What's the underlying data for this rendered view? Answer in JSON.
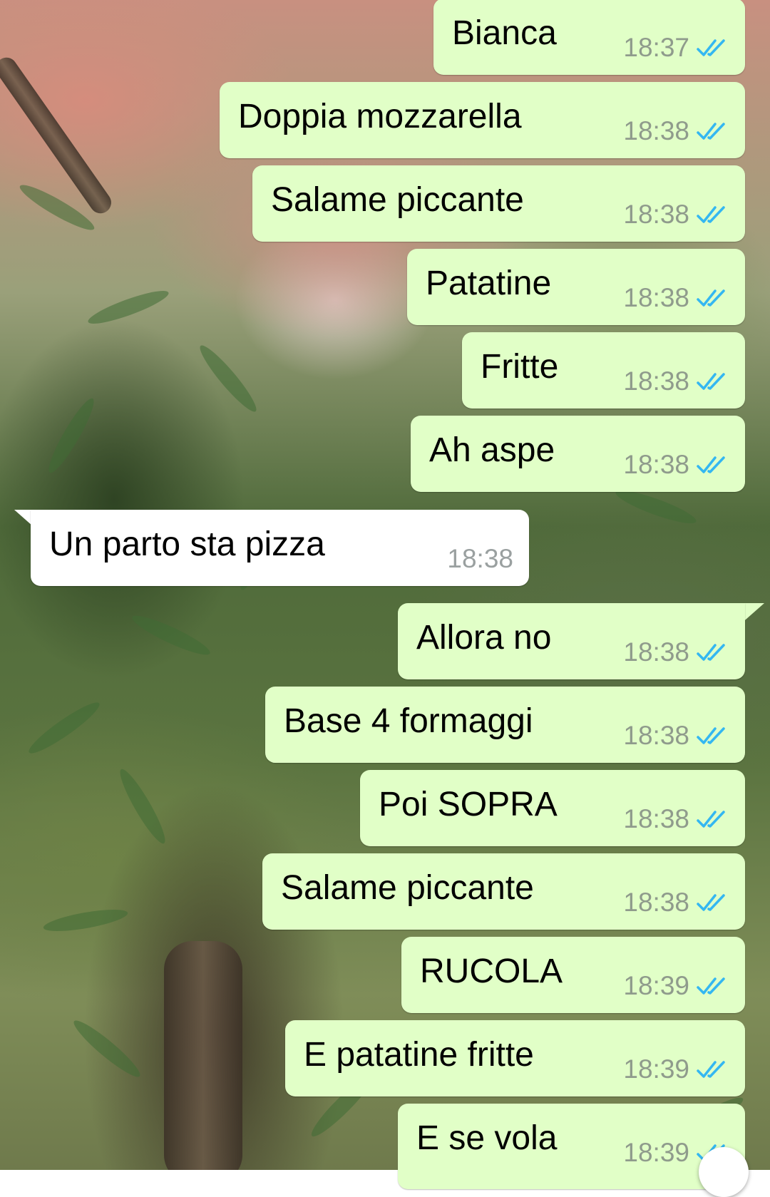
{
  "messages": [
    {
      "direction": "out",
      "text": "Bianca",
      "time": "18:37",
      "status": "read"
    },
    {
      "direction": "out",
      "text": "Doppia mozzarella",
      "time": "18:38",
      "status": "read"
    },
    {
      "direction": "out",
      "text": "Salame piccante",
      "time": "18:38",
      "status": "read"
    },
    {
      "direction": "out",
      "text": "Patatine",
      "time": "18:38",
      "status": "read"
    },
    {
      "direction": "out",
      "text": "Fritte",
      "time": "18:38",
      "status": "read"
    },
    {
      "direction": "out",
      "text": "Ah aspe",
      "time": "18:38",
      "status": "read"
    },
    {
      "direction": "in",
      "text": "Un parto sta pizza",
      "time": "18:38"
    },
    {
      "direction": "out",
      "text": "Allora no",
      "time": "18:38",
      "status": "read"
    },
    {
      "direction": "out",
      "text": "Base 4 formaggi",
      "time": "18:38",
      "status": "read"
    },
    {
      "direction": "out",
      "text": "Poi SOPRA",
      "time": "18:38",
      "status": "read"
    },
    {
      "direction": "out",
      "text": "Salame piccante",
      "time": "18:38",
      "status": "read"
    },
    {
      "direction": "out",
      "text": "RUCOLA",
      "time": "18:39",
      "status": "read"
    },
    {
      "direction": "out",
      "text": "E patatine fritte",
      "time": "18:39",
      "status": "read"
    },
    {
      "direction": "out",
      "text": "E se vola",
      "time": "18:39",
      "status": "read"
    }
  ],
  "colors": {
    "outgoing_bubble": "#e1ffc7",
    "incoming_bubble": "#ffffff",
    "read_ticks": "#34b7f1",
    "timestamp": "#8f9b8c"
  },
  "icons": {
    "read_receipt": "double-check-icon",
    "scroll_button": "scroll-down-button"
  }
}
